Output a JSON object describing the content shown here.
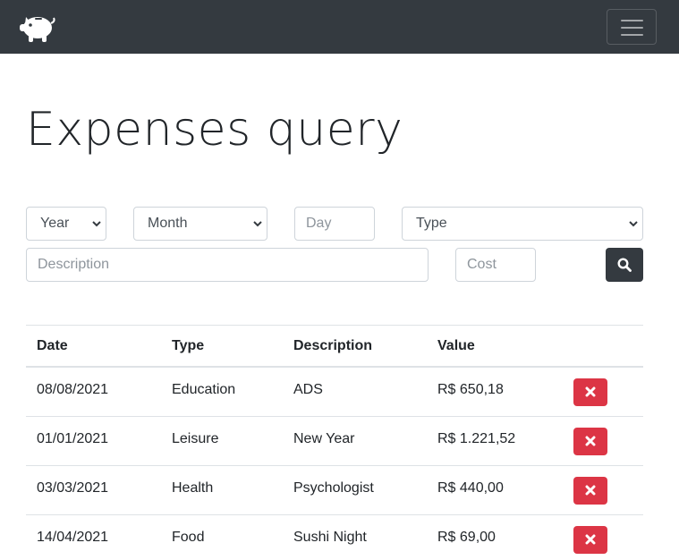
{
  "navbar": {
    "logo_icon": "piggy-bank-icon",
    "toggler_icon": "hamburger-menu-icon",
    "background": "#343a40"
  },
  "page": {
    "title": "Expenses query"
  },
  "filters": {
    "year": {
      "selected": "Year"
    },
    "month": {
      "selected": "Month"
    },
    "day": {
      "placeholder": "Day",
      "value": ""
    },
    "type": {
      "selected": "Type"
    },
    "description": {
      "placeholder": "Description",
      "value": ""
    },
    "cost": {
      "placeholder": "Cost",
      "value": ""
    },
    "search_icon": "search-icon"
  },
  "table": {
    "headers": [
      "Date",
      "Type",
      "Description",
      "Value"
    ],
    "rows": [
      {
        "date": "08/08/2021",
        "type": "Education",
        "description": "ADS",
        "value": "R$ 650,18"
      },
      {
        "date": "01/01/2021",
        "type": "Leisure",
        "description": "New Year",
        "value": "R$ 1.221,52"
      },
      {
        "date": "03/03/2021",
        "type": "Health",
        "description": "Psychologist",
        "value": "R$ 440,00"
      },
      {
        "date": "14/04/2021",
        "type": "Food",
        "description": "Sushi Night",
        "value": "R$ 69,00"
      }
    ],
    "delete_icon": "close-icon",
    "delete_color": "#dc3545"
  }
}
